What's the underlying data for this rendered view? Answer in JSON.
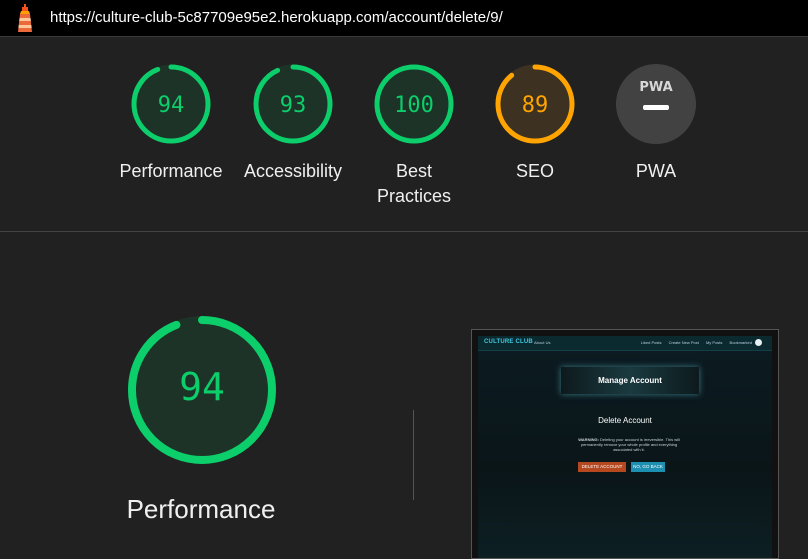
{
  "address_bar": {
    "url": "https://culture-club-5c87709e95e2.herokuapp.com/account/delete/9/"
  },
  "summary_gauges": [
    {
      "label": "Performance",
      "score": "94",
      "score_fraction": 0.94,
      "color": "#0cce6b"
    },
    {
      "label": "Accessibility",
      "score": "93",
      "score_fraction": 0.93,
      "color": "#0cce6b"
    },
    {
      "label": "Best Practices",
      "score": "100",
      "score_fraction": 1.0,
      "color": "#0cce6b"
    },
    {
      "label": "SEO",
      "score": "89",
      "score_fraction": 0.89,
      "color": "#ffa400"
    },
    {
      "label": "PWA",
      "badge": "PWA"
    }
  ],
  "performance_detail": {
    "score": "94",
    "score_fraction": 0.94,
    "label": "Performance",
    "color": "#0cce6b"
  },
  "screenshot_thumbnail": {
    "brand": "CULTURE CLUB",
    "about": "About Us",
    "nav_links": [
      "Liked Posts",
      "Create New Post",
      "My Posts",
      "Bookmarked"
    ],
    "card_title": "Manage Account",
    "section_title": "Delete Account",
    "warning_label": "WARNING:",
    "warning_text": "Deleting your account is irreversible. This will permanently remove your whole profile and everything associated with it.",
    "delete_button": "DELETE ACCOUNT",
    "back_button": "NO, GO BACK"
  },
  "colors": {
    "background": "#212121",
    "pass": "#0cce6b",
    "average": "#ffa400",
    "pwa_gray": "#424242"
  }
}
